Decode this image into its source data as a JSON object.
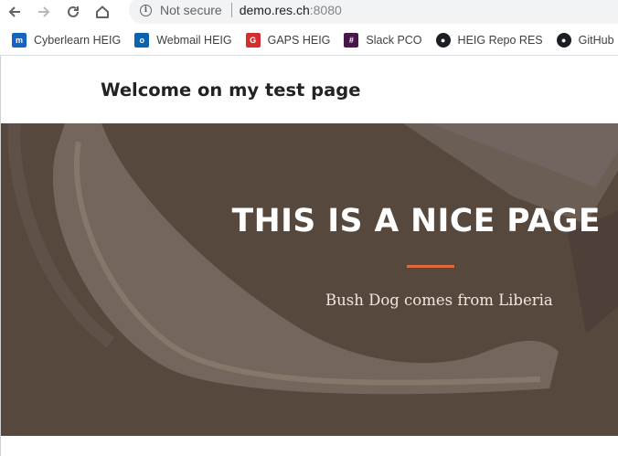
{
  "browser": {
    "security_label": "Not secure",
    "url_host": "demo.res.ch",
    "url_port": ":8080",
    "bookmarks": [
      {
        "label": "Cyberlearn HEIG",
        "icon": "cyberlearn-icon",
        "color": "#1565c0"
      },
      {
        "label": "Webmail HEIG",
        "icon": "outlook-icon",
        "color": "#0a64ad"
      },
      {
        "label": "GAPS HEIG",
        "icon": "gaps-icon",
        "color": "#d32f2f"
      },
      {
        "label": "Slack PCO",
        "icon": "slack-icon",
        "color": "#4a154b"
      },
      {
        "label": "HEIG Repo RES",
        "icon": "github-icon",
        "color": "#1b1f23"
      },
      {
        "label": "GitHub",
        "icon": "github-icon",
        "color": "#1b1f23"
      }
    ]
  },
  "site": {
    "brand": "Welcome on my test page"
  },
  "hero": {
    "title": "THIS IS A NICE PAGE",
    "subtitle": "Bush Dog comes from Liberia",
    "accent_color": "#e0683a",
    "overlay_color": "#5b4c43"
  }
}
